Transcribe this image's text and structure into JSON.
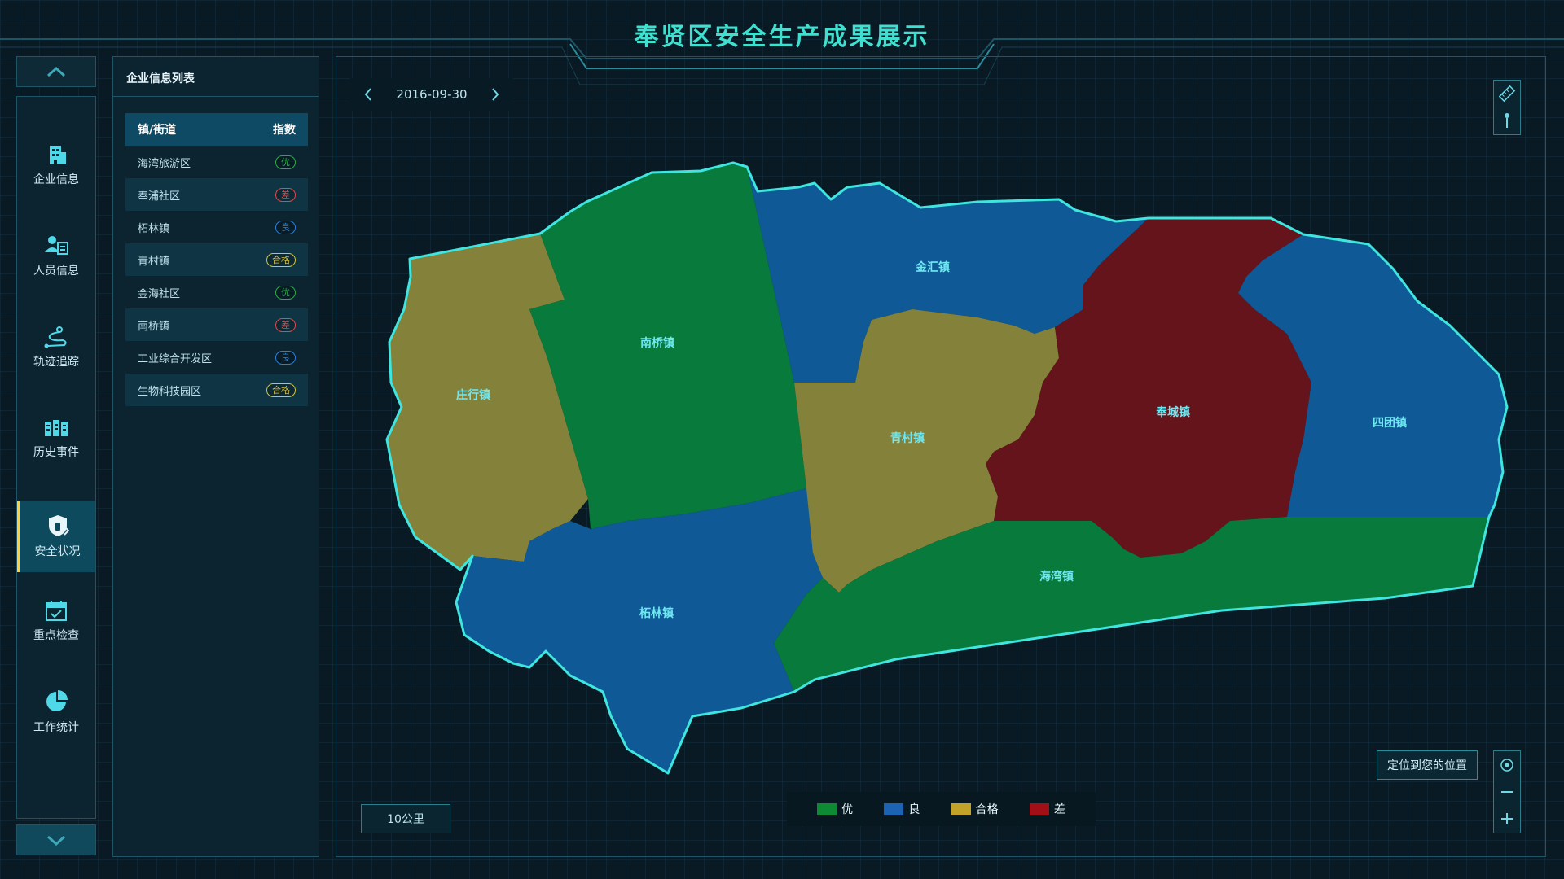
{
  "title": "奉贤区安全生产成果展示",
  "nav": [
    {
      "label": "企业信息",
      "icon": "building-icon"
    },
    {
      "label": "人员信息",
      "icon": "person-card-icon"
    },
    {
      "label": "轨迹追踪",
      "icon": "route-icon"
    },
    {
      "label": "历史事件",
      "icon": "history-icon"
    },
    {
      "label": "安全状况",
      "icon": "shield-icon",
      "active": true
    },
    {
      "label": "重点检查",
      "icon": "calendar-check-icon"
    },
    {
      "label": "工作统计",
      "icon": "pie-chart-icon"
    }
  ],
  "list": {
    "title": "企业信息列表",
    "col_area": "镇/街道",
    "col_index": "指数",
    "rows": [
      {
        "name": "海湾旅游区",
        "grade": "优"
      },
      {
        "name": "奉浦社区",
        "grade": "差"
      },
      {
        "name": "柘林镇",
        "grade": "良"
      },
      {
        "name": "青村镇",
        "grade": "合格"
      },
      {
        "name": "金海社区",
        "grade": "优"
      },
      {
        "name": "南桥镇",
        "grade": "差"
      },
      {
        "name": "工业综合开发区",
        "grade": "良"
      },
      {
        "name": "生物科技园区",
        "grade": "合格"
      }
    ]
  },
  "grade_colors": {
    "优": "#2ea84a",
    "良": "#2a7fd8",
    "合格": "#d8c23a",
    "差": "#e04a4a"
  },
  "date": "2016-09-30",
  "map": {
    "regions": [
      {
        "name": "庄行镇",
        "grade": "合格",
        "fill": "#84813a"
      },
      {
        "name": "南桥镇",
        "grade": "优",
        "fill": "#077a3c"
      },
      {
        "name": "金汇镇",
        "grade": "良",
        "fill": "#0f5a96"
      },
      {
        "name": "青村镇",
        "grade": "合格",
        "fill": "#84813a"
      },
      {
        "name": "奉城镇",
        "grade": "差",
        "fill": "#66141c"
      },
      {
        "name": "四团镇",
        "grade": "良",
        "fill": "#0f5a96"
      },
      {
        "name": "柘林镇",
        "grade": "良",
        "fill": "#0f5a96"
      },
      {
        "name": "海湾镇",
        "grade": "优",
        "fill": "#077a3c"
      }
    ],
    "border_color": "#3fe6e0"
  },
  "legend": [
    {
      "label": "优",
      "color": "#0f8a34"
    },
    {
      "label": "良",
      "color": "#1c63b4"
    },
    {
      "label": "合格",
      "color": "#c2a229"
    },
    {
      "label": "差",
      "color": "#a30f16"
    }
  ],
  "locate_label": "定位到您的位置",
  "scale_label": "10公里"
}
